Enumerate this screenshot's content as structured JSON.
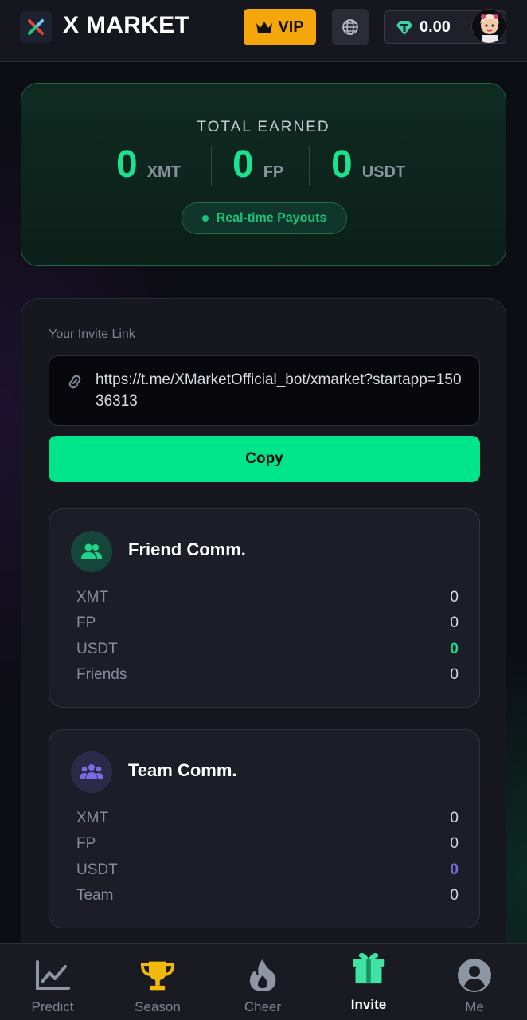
{
  "header": {
    "app_title": "X MARKET",
    "vip_label": "VIP",
    "balance": "0.00",
    "icons": {
      "logo": "x-market-logo",
      "vip": "crown-icon",
      "language": "globe-icon",
      "currency": "tether-icon"
    }
  },
  "earned": {
    "title": "TOTAL EARNED",
    "items": [
      {
        "value": "0",
        "unit": "XMT"
      },
      {
        "value": "0",
        "unit": "FP"
      },
      {
        "value": "0",
        "unit": "USDT"
      }
    ],
    "payout_label": "Real-time Payouts"
  },
  "invite": {
    "label": "Your Invite Link",
    "link": "https://t.me/XMarketOfficial_bot/xmarket?startapp=15036313",
    "copy_label": "Copy"
  },
  "friend_comm": {
    "title": "Friend Comm.",
    "rows": [
      {
        "label": "XMT",
        "value": "0"
      },
      {
        "label": "FP",
        "value": "0"
      },
      {
        "label": "USDT",
        "value": "0"
      },
      {
        "label": "Friends",
        "value": "0"
      }
    ]
  },
  "team_comm": {
    "title": "Team Comm.",
    "rows": [
      {
        "label": "XMT",
        "value": "0"
      },
      {
        "label": "FP",
        "value": "0"
      },
      {
        "label": "USDT",
        "value": "0"
      },
      {
        "label": "Team",
        "value": "0"
      }
    ]
  },
  "nav": {
    "items": [
      {
        "label": "Predict",
        "icon": "chart-line-icon"
      },
      {
        "label": "Season",
        "icon": "trophy-icon"
      },
      {
        "label": "Cheer",
        "icon": "flame-icon"
      },
      {
        "label": "Invite",
        "icon": "gift-icon",
        "active": true
      },
      {
        "label": "Me",
        "icon": "user-icon"
      }
    ]
  },
  "colors": {
    "accent_green": "#00e48a",
    "vip_orange": "#f5a60a",
    "team_purple": "#7b6ae0",
    "background": "#0d0d14"
  }
}
